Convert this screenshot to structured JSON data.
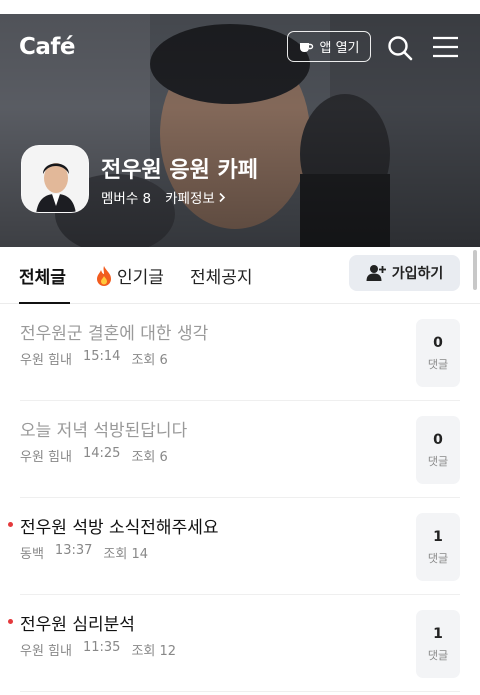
{
  "header": {
    "logo": "Café",
    "app_button_label": "앱 열기",
    "cafe_name": "전우원 응원 카페",
    "member_label": "멤버수 8",
    "info_label": "카페정보"
  },
  "tabs": [
    {
      "label": "전체글",
      "active": true
    },
    {
      "label": "인기글",
      "active": false,
      "icon": "fire-icon"
    },
    {
      "label": "전체공지",
      "active": false
    }
  ],
  "join_button_label": "가입하기",
  "posts": [
    {
      "title": "전우원군 결혼에 대한 생각",
      "author": "우원 힘내",
      "time": "15:14",
      "views": "조회 6",
      "comments": "0",
      "comment_label": "댓글",
      "read": true,
      "new": false
    },
    {
      "title": "오늘 저녁 석방된답니다",
      "author": "우원 힘내",
      "time": "14:25",
      "views": "조회 6",
      "comments": "0",
      "comment_label": "댓글",
      "read": true,
      "new": false
    },
    {
      "title": "전우원 석방 소식전해주세요",
      "author": "동백",
      "time": "13:37",
      "views": "조회 14",
      "comments": "1",
      "comment_label": "댓글",
      "read": false,
      "new": true
    },
    {
      "title": "전우원 심리분석",
      "author": "우원 힘내",
      "time": "11:35",
      "views": "조회 12",
      "comments": "1",
      "comment_label": "댓글",
      "read": false,
      "new": true
    }
  ],
  "colors": {
    "new_dot": "#e4393c",
    "read_title": "#9a9a9a",
    "join_bg": "#e9ecf1"
  }
}
